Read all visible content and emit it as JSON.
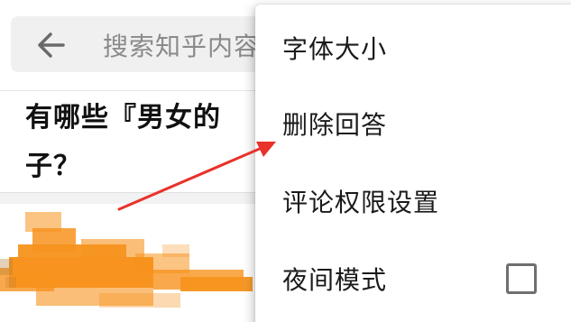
{
  "search": {
    "placeholder": "搜索知乎内容"
  },
  "question": {
    "title": "有哪些『男女的区别』的小例子？",
    "visible_line1": "有哪些『男女的",
    "visible_line2": "子？"
  },
  "menu": {
    "items": [
      {
        "label": "字体大小"
      },
      {
        "label": "删除回答"
      },
      {
        "label": "评论权限设置"
      },
      {
        "label": "夜间模式",
        "checked": false
      }
    ]
  },
  "colors": {
    "annotation_arrow": "#e8322a",
    "redaction": "#f7931e",
    "search_bg": "#f0f0f1"
  },
  "icons": {
    "back": "back-arrow-icon",
    "checkbox": "checkbox-icon"
  }
}
